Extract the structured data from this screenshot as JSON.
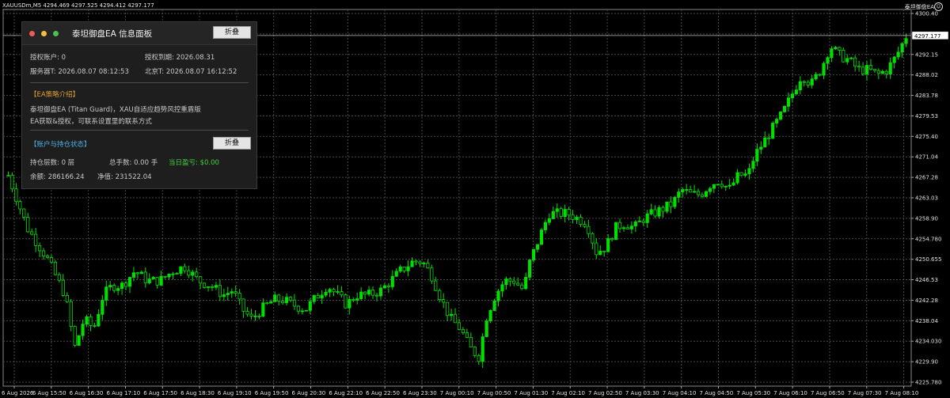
{
  "chart": {
    "symbol_info": "XAUUSDm,M5  4294.469 4297.525 4294.412 4297.177",
    "ea_name": "泰坦御盘EA",
    "ea_face_glyph": "☺",
    "current_price": "4297.177",
    "colors": {
      "background": "#000000",
      "grid": "#4a4a4a",
      "candle": "#00e000",
      "price_line": "#c0c0c0",
      "price_label_bg": "#ffffff"
    }
  },
  "chart_data": {
    "type": "candlestick",
    "price_labels": [
      "4300.40",
      "4296.280",
      "4292.15",
      "4288.02",
      "4283.78",
      "4279.53",
      "4275.40",
      "4271.04",
      "4267.28",
      "4263.03",
      "4258.90",
      "4254.780",
      "4250.655",
      "4246.53",
      "4242.28",
      "4238.04",
      "4234.030",
      "4229.90",
      "4225.780"
    ],
    "ylim": [
      4224.0,
      4302.6
    ],
    "time_labels": [
      "6 Aug 2026",
      "6 Aug 15:50",
      "6 Aug 16:30",
      "6 Aug 17:10",
      "6 Aug 17:50",
      "6 Aug 18:30",
      "6 Aug 19:10",
      "6 Aug 19:50",
      "6 Aug 20:30",
      "6 Aug 22:10",
      "6 Aug 22:50",
      "6 Aug 23:30",
      "7 Aug 00:10",
      "7 Aug 00:50",
      "7 Aug 01:30",
      "7 Aug 02:10",
      "7 Aug 02:50",
      "7 Aug 03:30",
      "7 Aug 04:10",
      "7 Aug 04:50",
      "7 Aug 05:30",
      "7 Aug 06:10",
      "7 Aug 06:50",
      "7 Aug 07:30",
      "7 Aug 08:10"
    ],
    "price_path": [
      [
        0,
        4268
      ],
      [
        6,
        4257
      ],
      [
        12,
        4251
      ],
      [
        18,
        4243
      ],
      [
        21,
        4232
      ],
      [
        24,
        4238
      ],
      [
        27,
        4236
      ],
      [
        30,
        4243
      ],
      [
        33,
        4245
      ],
      [
        36,
        4245
      ],
      [
        40,
        4248
      ],
      [
        44,
        4246
      ],
      [
        48,
        4246
      ],
      [
        52,
        4248
      ],
      [
        56,
        4249
      ],
      [
        60,
        4246
      ],
      [
        64,
        4245
      ],
      [
        68,
        4243
      ],
      [
        71,
        4244
      ],
      [
        74,
        4240
      ],
      [
        77,
        4238
      ],
      [
        80,
        4240
      ],
      [
        84,
        4242
      ],
      [
        87,
        4242
      ],
      [
        90,
        4241
      ],
      [
        94,
        4240
      ],
      [
        98,
        4243
      ],
      [
        101,
        4245
      ],
      [
        104,
        4243
      ],
      [
        107,
        4241
      ],
      [
        110,
        4243
      ],
      [
        114,
        4243
      ],
      [
        118,
        4244
      ],
      [
        121,
        4246
      ],
      [
        124,
        4248
      ],
      [
        128,
        4250
      ],
      [
        131,
        4250
      ],
      [
        134,
        4247
      ],
      [
        137,
        4242
      ],
      [
        140,
        4238
      ],
      [
        143,
        4236
      ],
      [
        146,
        4232
      ],
      [
        149,
        4230
      ],
      [
        151,
        4238
      ],
      [
        154,
        4243
      ],
      [
        157,
        4246
      ],
      [
        160,
        4246
      ],
      [
        163,
        4244
      ],
      [
        165,
        4250
      ],
      [
        168,
        4255
      ],
      [
        171,
        4260
      ],
      [
        174,
        4260
      ],
      [
        177,
        4260
      ],
      [
        180,
        4259
      ],
      [
        183,
        4258
      ],
      [
        186,
        4252
      ],
      [
        189,
        4253
      ],
      [
        192,
        4257
      ],
      [
        195,
        4258
      ],
      [
        198,
        4257
      ],
      [
        201,
        4259
      ],
      [
        204,
        4260
      ],
      [
        207,
        4261
      ],
      [
        210,
        4262
      ],
      [
        213,
        4265
      ],
      [
        216,
        4264
      ],
      [
        219,
        4264
      ],
      [
        222,
        4266
      ],
      [
        225,
        4267
      ],
      [
        228,
        4265
      ],
      [
        231,
        4268
      ],
      [
        234,
        4268
      ],
      [
        236,
        4272
      ],
      [
        239,
        4275
      ],
      [
        242,
        4278
      ],
      [
        245,
        4281
      ],
      [
        248,
        4285
      ],
      [
        251,
        4289
      ],
      [
        254,
        4287
      ],
      [
        257,
        4290
      ],
      [
        260,
        4295
      ],
      [
        263,
        4293
      ],
      [
        266,
        4292
      ],
      [
        269,
        4290
      ],
      [
        272,
        4290
      ],
      [
        275,
        4289
      ],
      [
        278,
        4290
      ],
      [
        281,
        4293
      ],
      [
        284,
        4297
      ]
    ]
  },
  "panel": {
    "title": "泰坦御盘EA 信息面板",
    "collapse_label": "折叠",
    "auth_account": "授权账户: 0",
    "auth_expiry": "授权到期: 2026.08.31",
    "server_time": "服务器T: 2026.08.07 08:12:53",
    "beijing_time": "北京T: 2026.08.07 16:12:52",
    "strategy_title": "【EA策略介绍】",
    "strategy_line1": "泰坦御盘EA (Titan Guard)，XAU自适应趋势风控重盾版",
    "strategy_line2": "EA获取&授权，可联系设置里的联系方式",
    "account_title": "【账户与持仓状态】",
    "account_collapse_label": "折叠",
    "positions_layers": "持仓层数: 0 层",
    "total_lots": "总手数: 0.00 手",
    "today_profit": "当日盈亏: $0.00",
    "balance": "余额: 286166.24",
    "equity": "净值: 231522.04"
  }
}
